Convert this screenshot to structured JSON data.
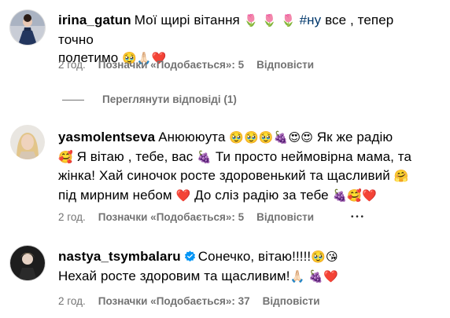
{
  "comments": [
    {
      "username": "irina_gatun",
      "line1_text": "Мої щирі вітання ",
      "line1_emoji": "🌷 🌷 🌷",
      "hashtag": "#ну",
      "line1_tail": " все , тепер точно",
      "line2_text": "полетимо ",
      "line2_emoji": "🥹🙏🏻❤️",
      "time": "2 год.",
      "likes": "Позначки «Подобається»: 5",
      "reply": "Відповісти"
    },
    {
      "username": "yasmolentseva",
      "line1_text": "Анюююута ",
      "line1_emoji": "🥹🥹🥹🍇😍😍",
      "line1_tail": " Як же радію",
      "line2_emoji": "🥰",
      "line2_text": " Я вітаю , тебе, вас ",
      "line2_emoji2": "🍇",
      "line2_tail": " Ти просто неймовірна мама, та",
      "line3_text": "жінка! Хай синочок росте здоровенький та щасливий ",
      "line3_emoji": "🤗",
      "line4_text": "під мирним небом ",
      "line4_emoji": "❤️",
      "line4_tail": " До сліз радію за тебе ",
      "line4_emoji2": "🍇🥰❤️",
      "time": "2 год.",
      "likes": "Позначки «Подобається»: 5",
      "reply": "Відповісти",
      "more": "• • •"
    },
    {
      "username": "nastya_tsymbalaru",
      "line1_text": "Сонечко, вітаю!!!!!",
      "line1_emoji": "🥹😘",
      "line2_text": "Нехай росте здоровим та щасливим!",
      "line2_emoji": "🙏🏻 🍇❤️",
      "time": "2 год.",
      "likes": "Позначки «Подобається»: 37",
      "reply": "Відповісти"
    }
  ],
  "view_replies": "Переглянути відповіді (1)",
  "colors": {
    "secondary_text": "#737373",
    "hashtag": "#00376b",
    "verified": "#0095f6"
  }
}
